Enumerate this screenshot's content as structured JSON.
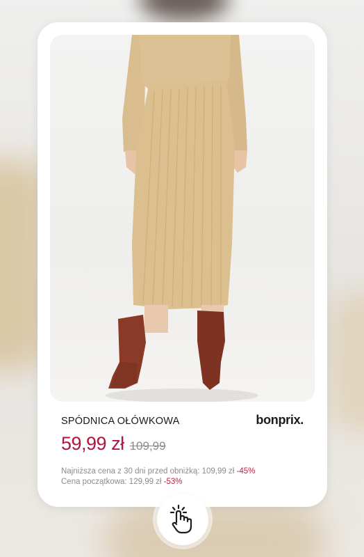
{
  "product": {
    "title": "SPÓDNICA OŁÓWKOWA",
    "brand_logo": "bonprix.",
    "price": "59,99 zł",
    "old_price": "109,99"
  },
  "price_info": {
    "lowest_label": "Najniższa cena z 30 dni  przed obniżką: 109,99 zł",
    "lowest_discount": "-45%",
    "initial_label": "Cena początkowa: 129,99 zł",
    "initial_discount": "-53%"
  },
  "colors": {
    "price": "#b0163e",
    "discount": "#c1203f"
  },
  "icons": {
    "tap": "hand-tap-icon"
  }
}
